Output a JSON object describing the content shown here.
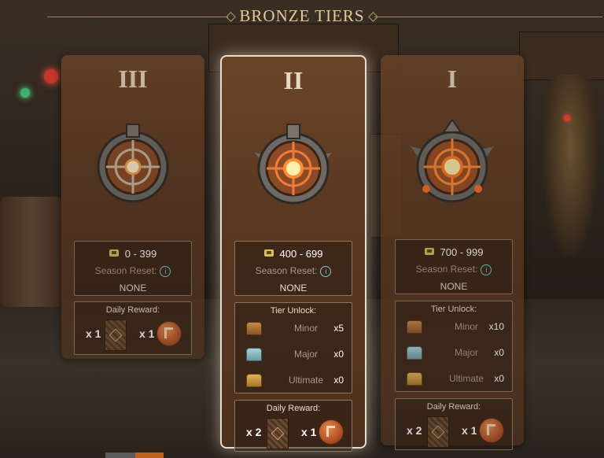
{
  "header": {
    "title": "BRONZE TIERS"
  },
  "tiers": [
    {
      "roman": "III",
      "range": "0 - 399",
      "season_reset_label": "Season Reset:",
      "season_reset_value": "NONE",
      "daily_reward": {
        "title": "Daily Reward:",
        "card_qty": "x 1",
        "coin_qty": "x 1"
      }
    },
    {
      "roman": "II",
      "range": "400 - 699",
      "season_reset_label": "Season Reset:",
      "season_reset_value": "NONE",
      "tier_unlock": {
        "title": "Tier Unlock:",
        "chests": [
          {
            "name": "Minor",
            "count": "x5"
          },
          {
            "name": "Major",
            "count": "x0"
          },
          {
            "name": "Ultimate",
            "count": "x0"
          }
        ]
      },
      "daily_reward": {
        "title": "Daily Reward:",
        "card_qty": "x 2",
        "coin_qty": "x 1"
      }
    },
    {
      "roman": "I",
      "range": "700 - 999",
      "season_reset_label": "Season Reset:",
      "season_reset_value": "NONE",
      "tier_unlock": {
        "title": "Tier Unlock:",
        "chests": [
          {
            "name": "Minor",
            "count": "x10"
          },
          {
            "name": "Major",
            "count": "x0"
          },
          {
            "name": "Ultimate",
            "count": "x0"
          }
        ]
      },
      "daily_reward": {
        "title": "Daily Reward:",
        "card_qty": "x 2",
        "coin_qty": "x 1"
      }
    }
  ],
  "icons": {
    "rank_points": "rank-points-icon",
    "info": "info-icon",
    "card_back": "card-back-icon",
    "coin": "coin-icon",
    "chest_minor": "minor-chest-icon",
    "chest_major": "major-chest-icon",
    "chest_ultimate": "ultimate-chest-icon"
  },
  "colors": {
    "title_gold": "#e6c79a",
    "info_teal": "#6fd0d8",
    "coin_orange": "#b5552a",
    "card_brown": "#5c3a22"
  }
}
